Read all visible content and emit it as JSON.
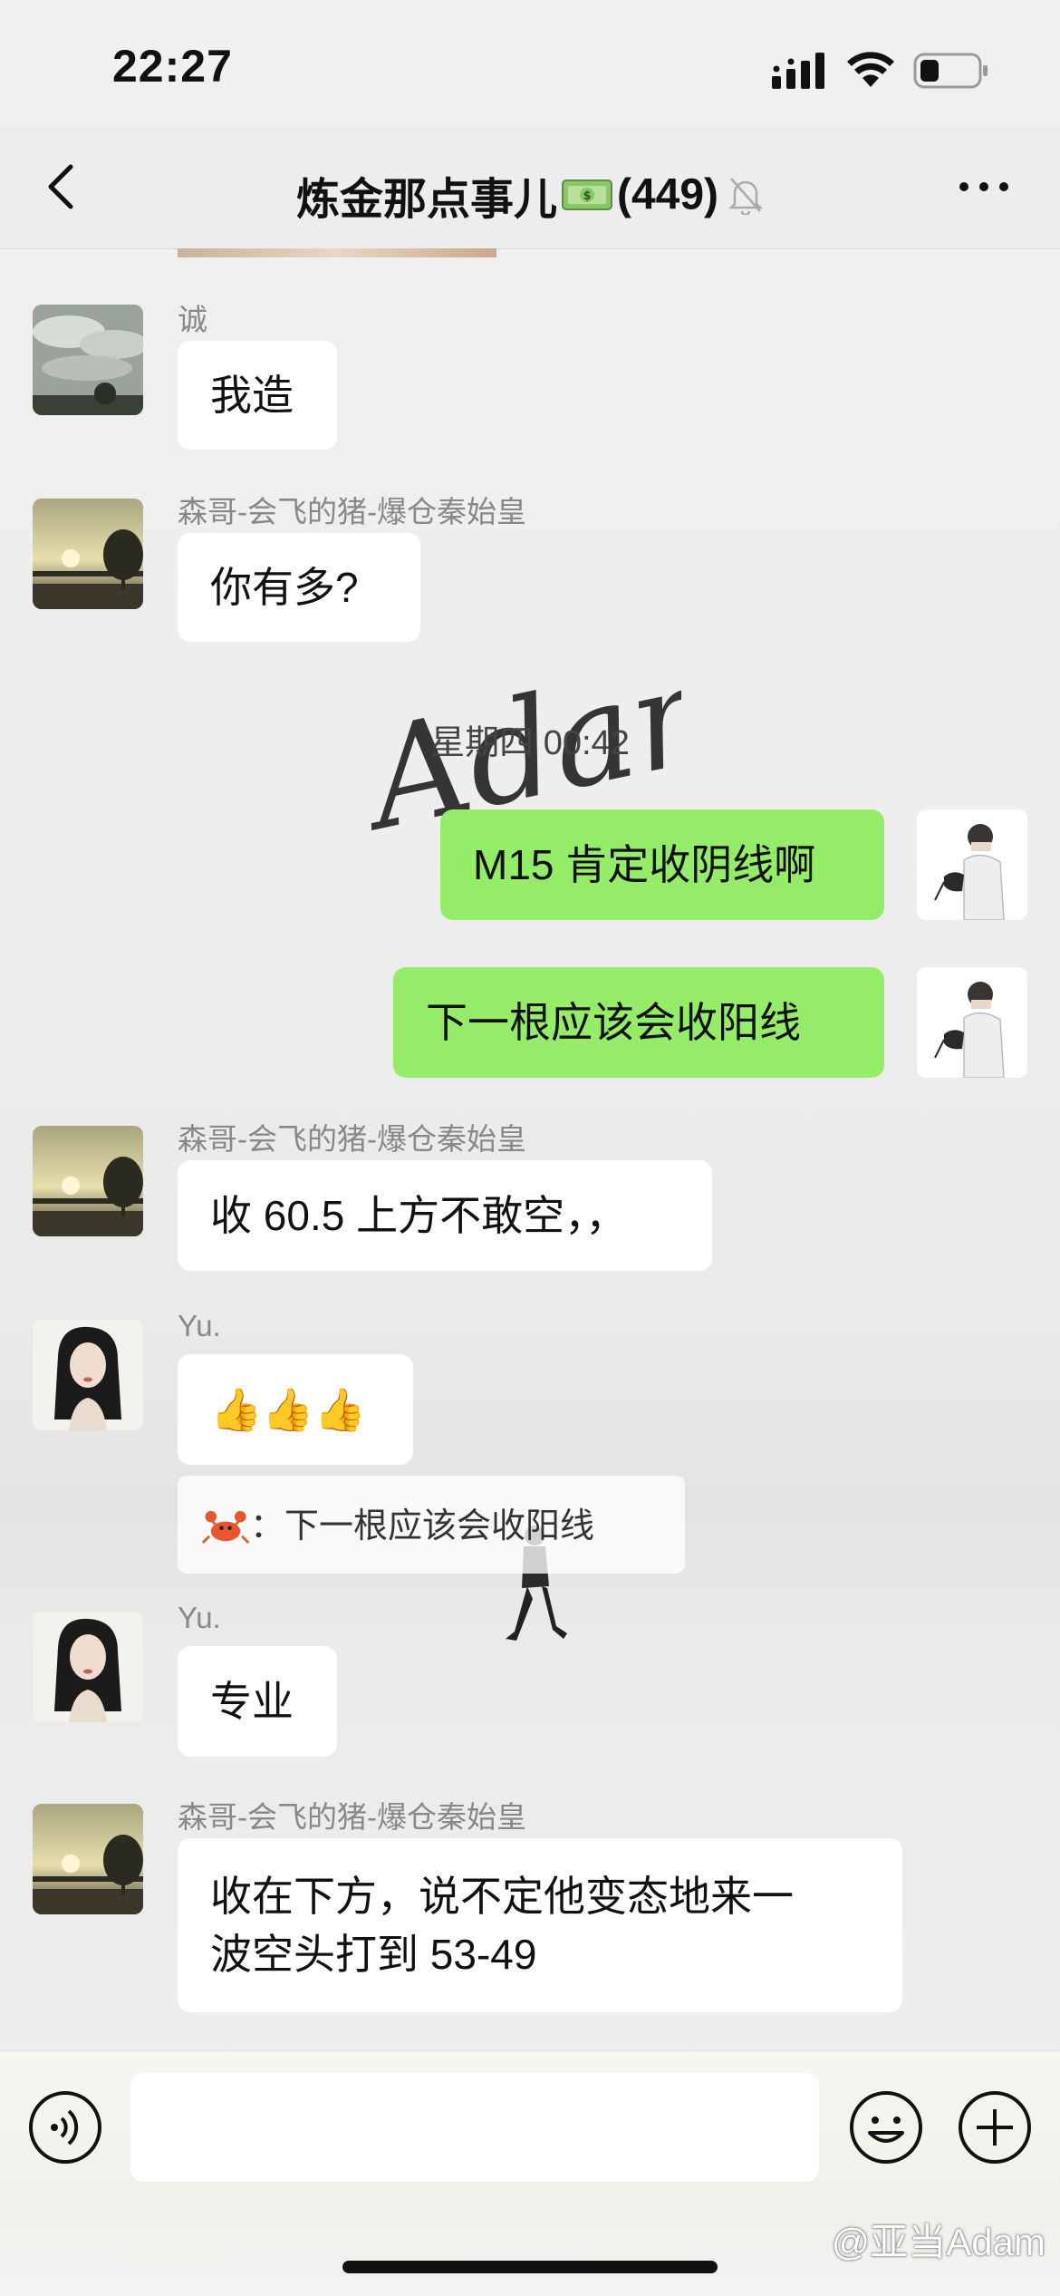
{
  "status": {
    "time": "22:27"
  },
  "header": {
    "back_icon": "chevron-left-icon",
    "title": "炼金那点事儿",
    "title_emoji": "money-bag-icon",
    "member_count": "(449)",
    "mute_icon": "bell-slash-icon",
    "more_icon": "more-dots-icon"
  },
  "messages": [
    {
      "sender": "诚",
      "text": "我造",
      "avatar": "clouds-avatar"
    },
    {
      "sender": "森哥-会飞的猪-爆仓秦始皇",
      "text": "你有多?",
      "avatar": "sunset-avatar"
    },
    {
      "timestamp": "星期四 00:42"
    },
    {
      "self": true,
      "text": "M15 肯定收阴线啊",
      "avatar": "man-with-kettle-avatar"
    },
    {
      "self": true,
      "text": "下一根应该会收阳线",
      "avatar": "man-with-kettle-avatar"
    },
    {
      "sender": "森哥-会飞的猪-爆仓秦始皇",
      "text": "收 60.5 上方不敢空，，",
      "avatar": "sunset-avatar"
    },
    {
      "sender": "Yu.",
      "text": "👍👍👍",
      "avatar": "woman-portrait-avatar",
      "quote": {
        "icon": "crab-icon",
        "text": "：下一根应该会收阳线"
      }
    },
    {
      "sender": "Yu.",
      "text": "专业",
      "avatar": "woman-portrait-avatar"
    },
    {
      "sender": "森哥-会飞的猪-爆仓秦始皇",
      "lines": [
        "收在下方，说不定他变态地来一",
        "波空头打到 53-49"
      ],
      "avatar": "sunset-avatar"
    }
  ],
  "watermark": "Adam",
  "input": {
    "voice_icon": "voice-icon",
    "emoji_icon": "emoji-icon",
    "plus_icon": "plus-icon",
    "value": ""
  },
  "credit": "@亚当Adam",
  "colors": {
    "self_bubble": "#95ec69",
    "other_bubble": "#ffffff",
    "background": "#ededed"
  }
}
